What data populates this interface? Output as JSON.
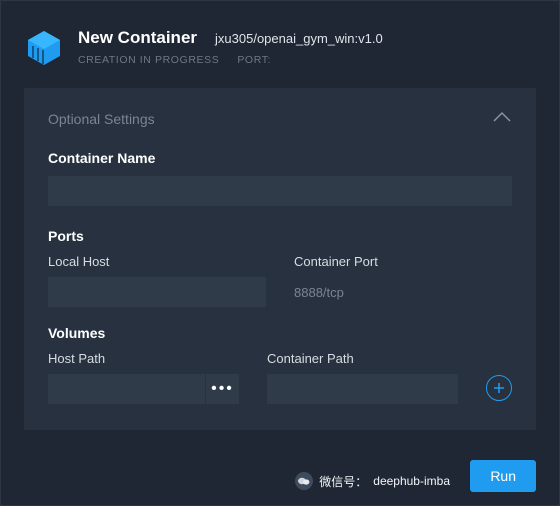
{
  "header": {
    "title": "New Container",
    "image": "jxu305/openai_gym_win:v1.0",
    "status": "CREATION IN PROGRESS",
    "port_label": "PORT:"
  },
  "panel": {
    "title": "Optional Settings",
    "container_name_label": "Container Name",
    "ports_label": "Ports",
    "local_host_label": "Local Host",
    "container_port_label": "Container Port",
    "container_port_value": "8888/tcp",
    "volumes_label": "Volumes",
    "host_path_label": "Host Path",
    "container_path_label": "Container Path"
  },
  "actions": {
    "run": "Run"
  },
  "watermark": {
    "label": "微信号：",
    "id": "deephub-imba"
  }
}
